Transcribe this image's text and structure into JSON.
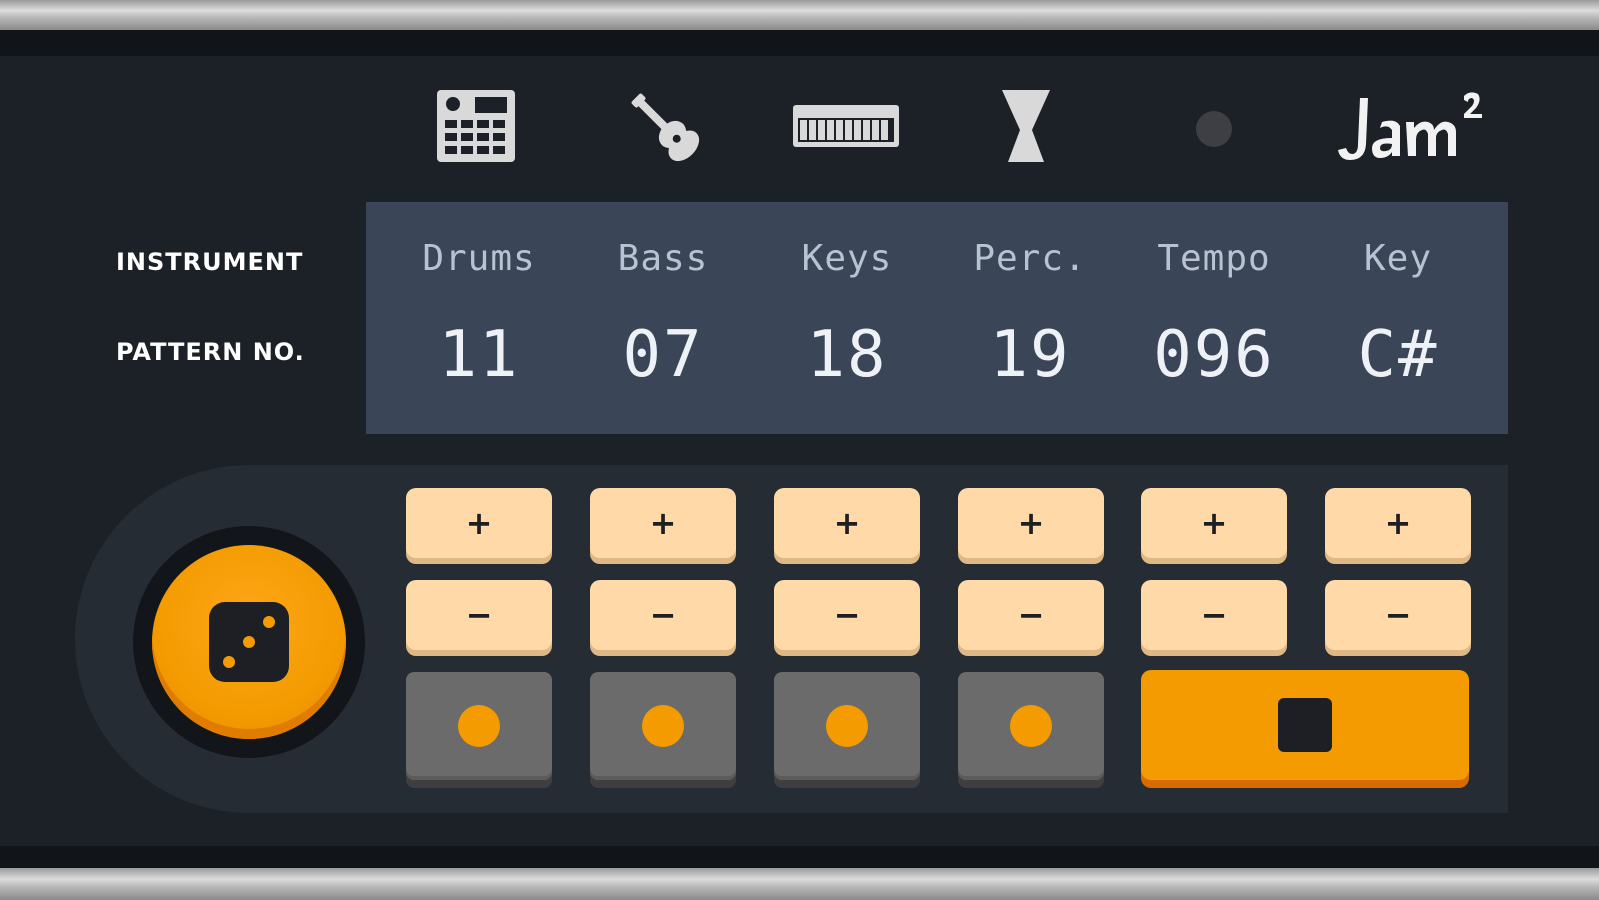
{
  "header": {
    "icons": [
      {
        "name": "drum-machine-icon"
      },
      {
        "name": "guitar-icon"
      },
      {
        "name": "keyboard-icon"
      },
      {
        "name": "djembe-icon"
      }
    ],
    "logo_text": "Jam²"
  },
  "labels": {
    "instrument": "INSTRUMENT",
    "pattern": "PATTERN NO."
  },
  "display": {
    "columns": [
      {
        "name": "Drums",
        "value": "11"
      },
      {
        "name": "Bass",
        "value": "07"
      },
      {
        "name": "Keys",
        "value": "18"
      },
      {
        "name": "Perc.",
        "value": "19"
      },
      {
        "name": "Tempo",
        "value": "096"
      },
      {
        "name": "Key",
        "value": "C#"
      }
    ]
  },
  "controls": {
    "plus_label": "+",
    "minus_label": "−"
  },
  "colors": {
    "accent": "#f39b00",
    "button": "#ffd9a8",
    "display_bg": "#3a4558",
    "panel_bg": "#1c2027"
  }
}
